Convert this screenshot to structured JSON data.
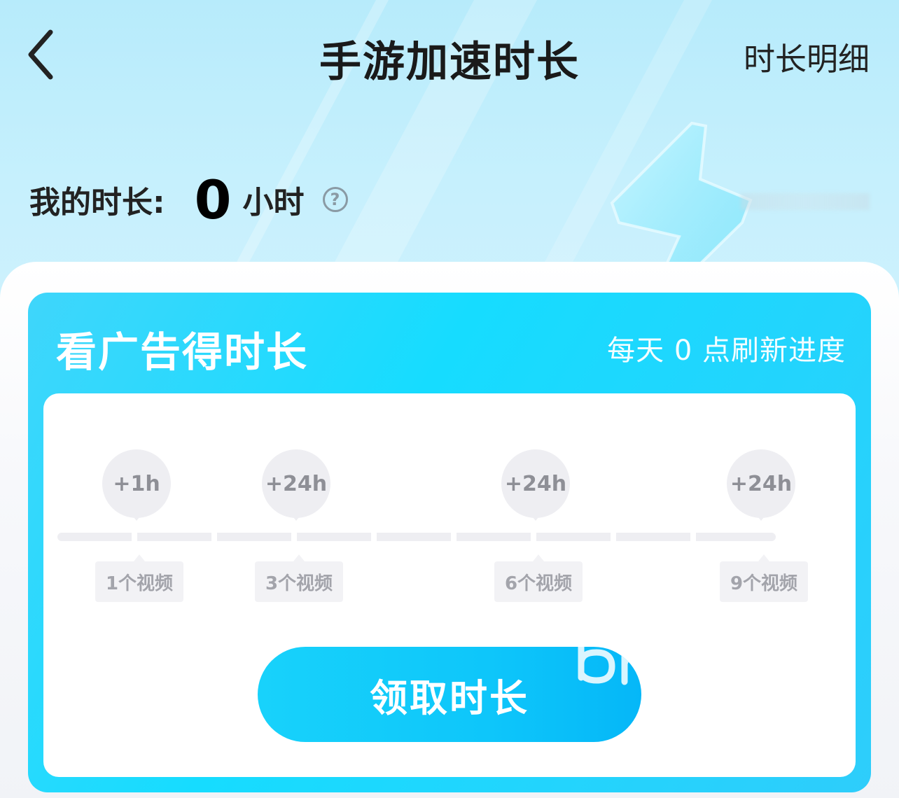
{
  "header": {
    "title": "手游加速时长",
    "detail_link": "时长明细"
  },
  "summary": {
    "label": "我的时长:",
    "value": "0",
    "unit": "小时",
    "help_icon": "?"
  },
  "ad_card": {
    "title": "看广告得时长",
    "refresh_note": "每天 0 点刷新进度",
    "milestones": [
      {
        "reward": "+1h",
        "requirement": "1个视频"
      },
      {
        "reward": "+24h",
        "requirement": "3个视频"
      },
      {
        "reward": "+24h",
        "requirement": "6个视频"
      },
      {
        "reward": "+24h",
        "requirement": "9个视频"
      }
    ],
    "progress": {
      "watched": 0,
      "total": 9
    },
    "claim_button": "领取时长"
  },
  "colors": {
    "card_accent": "#16dcff",
    "button_accent": "#0ec6fa",
    "muted": "#eeeef2"
  }
}
